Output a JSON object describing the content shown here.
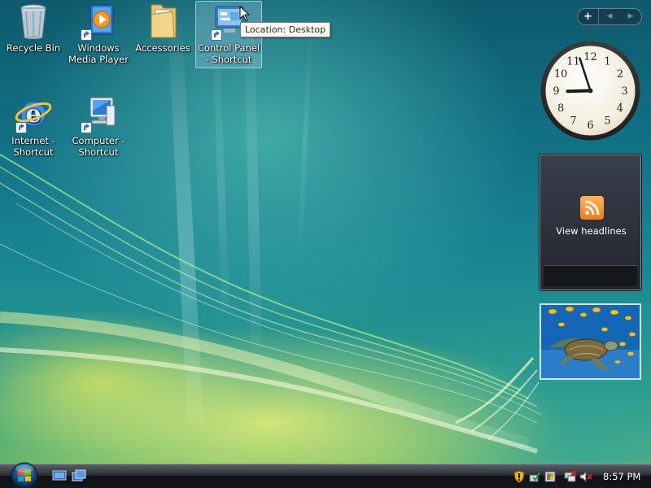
{
  "desktop": {
    "icons": [
      {
        "label": "Recycle Bin",
        "icon": "recycle-bin-icon",
        "shortcut": false
      },
      {
        "label": "Windows Media Player",
        "icon": "media-player-icon",
        "shortcut": true
      },
      {
        "label": "Accessories",
        "icon": "folder-icon",
        "shortcut": false
      },
      {
        "label": "Control Panel - Shortcut",
        "icon": "control-panel-icon",
        "shortcut": true,
        "selected": true
      },
      {
        "label": "Internet - Shortcut",
        "icon": "internet-explorer-icon",
        "shortcut": true
      },
      {
        "label": "Computer - Shortcut",
        "icon": "computer-icon",
        "shortcut": true
      }
    ],
    "tooltip": "Location: Desktop"
  },
  "sidebar": {
    "add_label": "+",
    "prev_label": "◀",
    "next_label": "▶",
    "clock": {
      "numerals": [
        "12",
        "1",
        "2",
        "3",
        "4",
        "5",
        "6",
        "7",
        "8",
        "9",
        "10",
        "11"
      ],
      "time_shown": "8:57"
    },
    "feed_headlines": {
      "label": "View headlines",
      "icon": "rss-feed-icon"
    },
    "slideshow": {
      "subject": "sea-turtle-image"
    }
  },
  "taskbar": {
    "start_icon": "windows-start-orb-icon",
    "quick_launch": [
      "show-desktop-icon",
      "switch-windows-icon"
    ],
    "tray_icons": [
      "security-shield-icon",
      "network-status-icon",
      "windows-update-icon",
      "network-disconnected-icon",
      "volume-muted-icon"
    ],
    "clock": "8:57 PM"
  },
  "colors": {
    "taskbar": "#14171b",
    "wallpaper_dark": "#0e5a6c",
    "wallpaper_light": "#e6ee78",
    "rss_orange": "#f27a1c"
  }
}
